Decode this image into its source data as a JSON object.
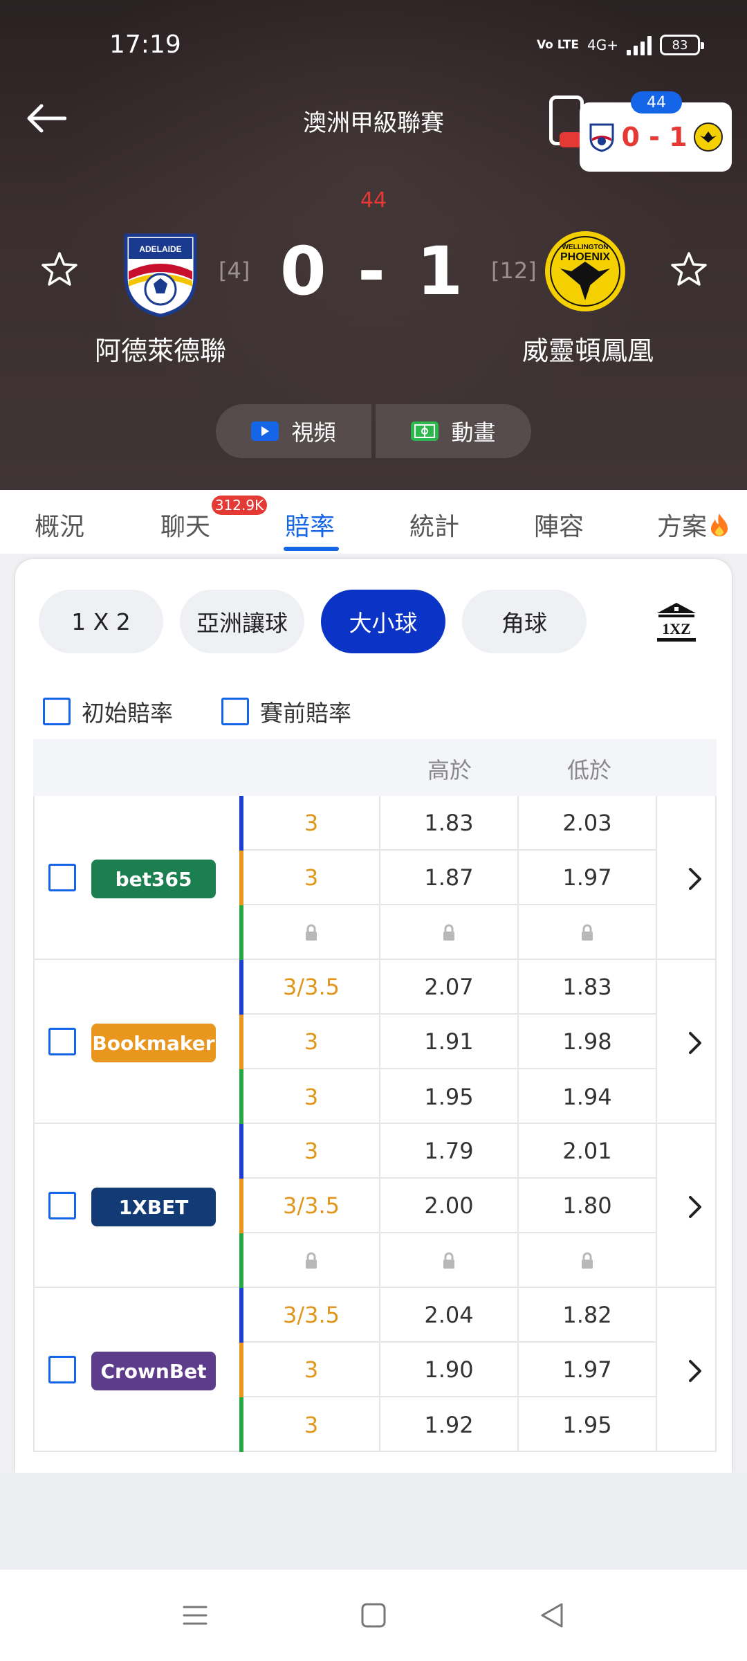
{
  "status": {
    "time": "17:19",
    "network": "4G+",
    "volte": "Vo LTE",
    "battery": "83"
  },
  "header": {
    "league": "澳洲甲級聯賽",
    "minute": "44",
    "score": "0 - 1",
    "home": {
      "name": "阿德萊德聯",
      "rank": "[4]"
    },
    "away": {
      "name": "威靈頓鳳凰",
      "rank": "[12]"
    },
    "mini_card": {
      "minute": "44",
      "score": "0 - 1"
    },
    "media": {
      "video": "視頻",
      "animation": "動畫"
    }
  },
  "tabs": [
    {
      "label": "概況"
    },
    {
      "label": "聊天",
      "badge": "312.9K"
    },
    {
      "label": "賠率",
      "active": true
    },
    {
      "label": "統計"
    },
    {
      "label": "陣容"
    },
    {
      "label": "方案"
    }
  ],
  "odds": {
    "types": [
      "1 X 2",
      "亞洲讓球",
      "大小球",
      "角球"
    ],
    "active_type": "大小球",
    "checkboxes": [
      "初始賠率",
      "賽前賠率"
    ],
    "columns": {
      "over": "高於",
      "under": "低於"
    },
    "bookmakers": [
      {
        "name": "bet365",
        "color": "#1b7f4f",
        "rows": [
          [
            "3",
            "1.83",
            "2.03"
          ],
          [
            "3",
            "1.87",
            "1.97"
          ],
          [
            "lock",
            "lock",
            "lock"
          ]
        ]
      },
      {
        "name": "Bookmaker",
        "color": "#e8961e",
        "rows": [
          [
            "3/3.5",
            "2.07",
            "1.83"
          ],
          [
            "3",
            "1.91",
            "1.98"
          ],
          [
            "3",
            "1.95",
            "1.94"
          ]
        ]
      },
      {
        "name": "1XBET",
        "color": "#123a75",
        "rows": [
          [
            "3",
            "1.79",
            "2.01"
          ],
          [
            "3/3.5",
            "2.00",
            "1.80"
          ],
          [
            "lock",
            "lock",
            "lock"
          ]
        ]
      },
      {
        "name": "CrownBet",
        "color": "#5e3c8c",
        "rows": [
          [
            "3/3.5",
            "2.04",
            "1.82"
          ],
          [
            "3",
            "1.90",
            "1.97"
          ],
          [
            "3",
            "1.92",
            "1.95"
          ]
        ]
      }
    ],
    "row_bar_colors": [
      "#1d3fd0",
      "#e8961e",
      "#28a745"
    ]
  }
}
